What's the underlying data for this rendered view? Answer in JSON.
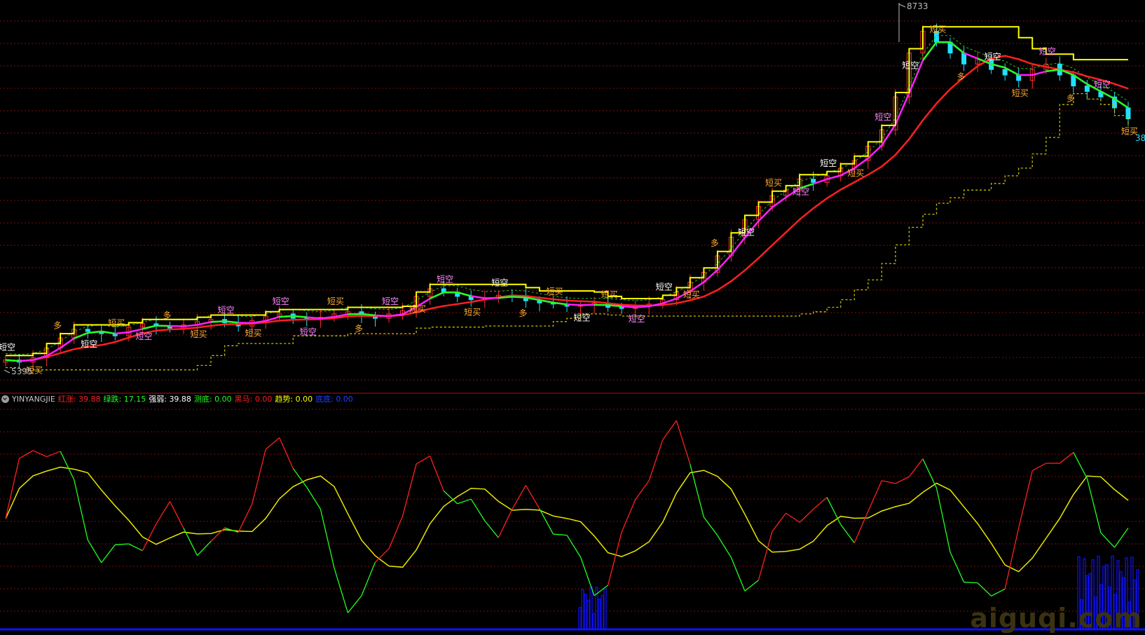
{
  "colors": {
    "background": "#000000",
    "grid": "#7a1010",
    "divider": "#b01010",
    "candle_up": "#ff3030",
    "candle_down": "#20e0ff",
    "upper_band": "#ffff00",
    "lower_band": "#c8c000",
    "ma_fast": "#ff20ff",
    "ma_slow": "#ff2020",
    "ma_green": "#20ff20",
    "osc_red": "#ff2020",
    "osc_green": "#20ff20",
    "osc_signal": "#e8e800",
    "volume_blue": "#1010ff",
    "label_pink": "#ff88ff",
    "label_orange": "#ffaa30",
    "label_white": "#ffffff"
  },
  "main_chart": {
    "high_marker": "8733",
    "low_marker": "5395",
    "last_value_label": "38",
    "signal_labels": [
      "短空",
      "短买",
      "多",
      "短空",
      "短买",
      "短空",
      "多",
      "短买",
      "短空",
      "短买",
      "短空",
      "短空",
      "短买",
      "多",
      "短空",
      "短买",
      "短空",
      "短买",
      "短空",
      "多",
      "短买",
      "短空",
      "短买",
      "短空",
      "短空",
      "短买",
      "多",
      "短空",
      "短买",
      "短空",
      "短空",
      "短买",
      "短空",
      "短空",
      "短买",
      "多",
      "短空",
      "短买",
      "短空",
      "多",
      "短空",
      "短买"
    ]
  },
  "indicator": {
    "name": "YINYANGJIE",
    "fields": [
      {
        "label": "红涨:",
        "value": "39.88",
        "color": "#ff2020"
      },
      {
        "label": "绿跌:",
        "value": "17.15",
        "color": "#20ff20"
      },
      {
        "label": "强弱:",
        "value": "39.88",
        "color": "#ffffff"
      },
      {
        "label": "测底:",
        "value": "0.00",
        "color": "#20ff20"
      },
      {
        "label": "黑马:",
        "value": "0.00",
        "color": "#ff2020"
      },
      {
        "label": "趋势:",
        "value": "0.00",
        "color": "#ffff00"
      },
      {
        "label": "底底:",
        "value": "0.00",
        "color": "#2040ff"
      }
    ]
  },
  "watermark": "aiguqi.com",
  "chart_data": {
    "type": "line",
    "title": "",
    "y_range": [
      5395,
      8733
    ],
    "series": [
      {
        "name": "",
        "values": [
          5500,
          5480,
          5520,
          5610,
          5700,
          5780,
          5760,
          5740,
          5720,
          5800,
          5830,
          5810,
          5790,
          5820,
          5850,
          5870,
          5840,
          5810,
          5860,
          5900,
          5920,
          5880,
          5870,
          5890,
          5920,
          5940,
          5900,
          5880,
          5920,
          5950,
          6080,
          6150,
          6120,
          6080,
          6050,
          6060,
          6090,
          6080,
          6040,
          6020,
          6010,
          5990,
          6000,
          6020,
          5980,
          5970,
          5990,
          6010,
          6050,
          6120,
          6210,
          6300,
          6450,
          6620,
          6780,
          6900,
          7000,
          7050,
          7150,
          7120,
          7180,
          7250,
          7320,
          7450,
          7600,
          7900,
          8300,
          8500,
          8400,
          8300,
          8200,
          8250,
          8150,
          8100,
          8050,
          8150,
          8200,
          8100,
          8000,
          7950,
          7900,
          7800,
          7700
        ]
      }
    ]
  }
}
